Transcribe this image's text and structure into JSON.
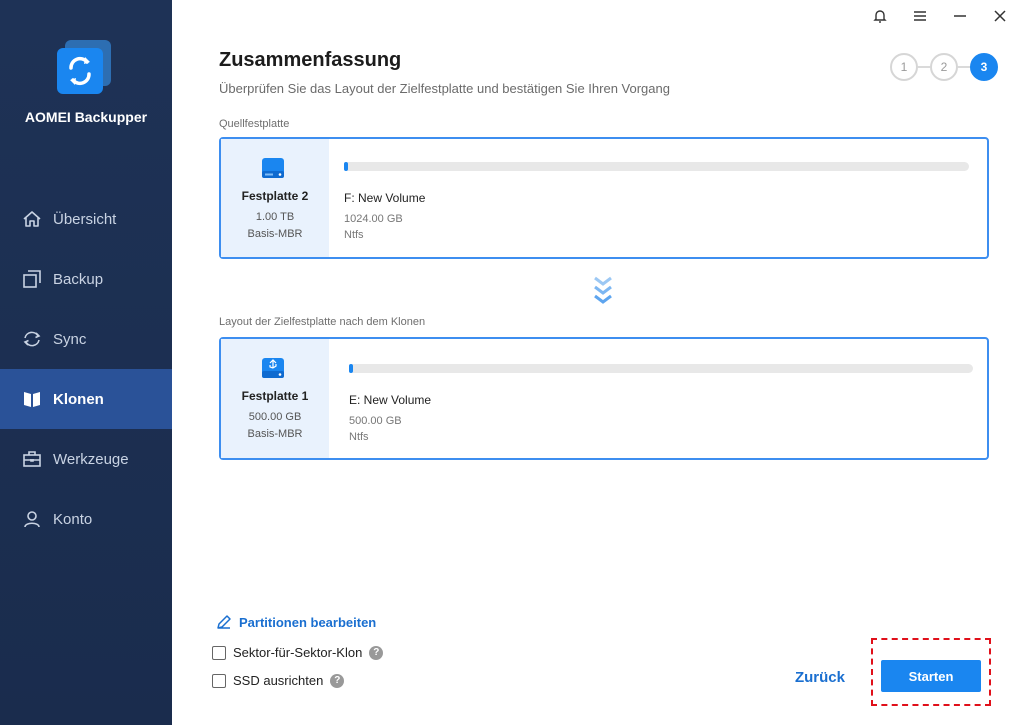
{
  "app": {
    "brand": "AOMEI Backupper"
  },
  "sidebar": {
    "items": [
      {
        "label": "Übersicht",
        "icon": "home-icon"
      },
      {
        "label": "Backup",
        "icon": "backup-icon"
      },
      {
        "label": "Sync",
        "icon": "sync-icon"
      },
      {
        "label": "Klonen",
        "icon": "clone-icon",
        "active": true
      },
      {
        "label": "Werkzeuge",
        "icon": "toolbox-icon"
      },
      {
        "label": "Konto",
        "icon": "user-icon"
      }
    ]
  },
  "window_controls": [
    "bell-icon",
    "menu-icon",
    "minimize-icon",
    "close-icon"
  ],
  "header": {
    "title": "Zusammenfassung",
    "subtitle": "Überprüfen Sie das Layout der Zielfestplatte und bestätigen Sie Ihren Vorgang"
  },
  "steps": {
    "items": [
      "1",
      "2",
      "3"
    ],
    "current": "3"
  },
  "source": {
    "label": "Quellfestplatte",
    "disk_name": "Festplatte 2",
    "disk_size": "1.00 TB",
    "disk_type": "Basis-MBR",
    "partition": {
      "name": "F: New Volume",
      "size": "1024.00 GB",
      "fs": "Ntfs"
    }
  },
  "target": {
    "label": "Layout der Zielfestplatte nach dem Klonen",
    "disk_name": "Festplatte 1",
    "disk_size": "500.00 GB",
    "disk_type": "Basis-MBR",
    "partition": {
      "name": "E: New Volume",
      "size": "500.00 GB",
      "fs": "Ntfs"
    }
  },
  "bottom": {
    "edit_partitions": "Partitionen bearbeiten",
    "sector_clone": "Sektor-für-Sektor-Klon",
    "ssd_align": "SSD ausrichten",
    "help_glyph": "?",
    "back": "Zurück",
    "start": "Starten"
  },
  "colors": {
    "sidebar_bg": "#1e3256",
    "accent": "#1a86f0",
    "active_nav": "#2a5298",
    "highlight": "#e0101a"
  }
}
